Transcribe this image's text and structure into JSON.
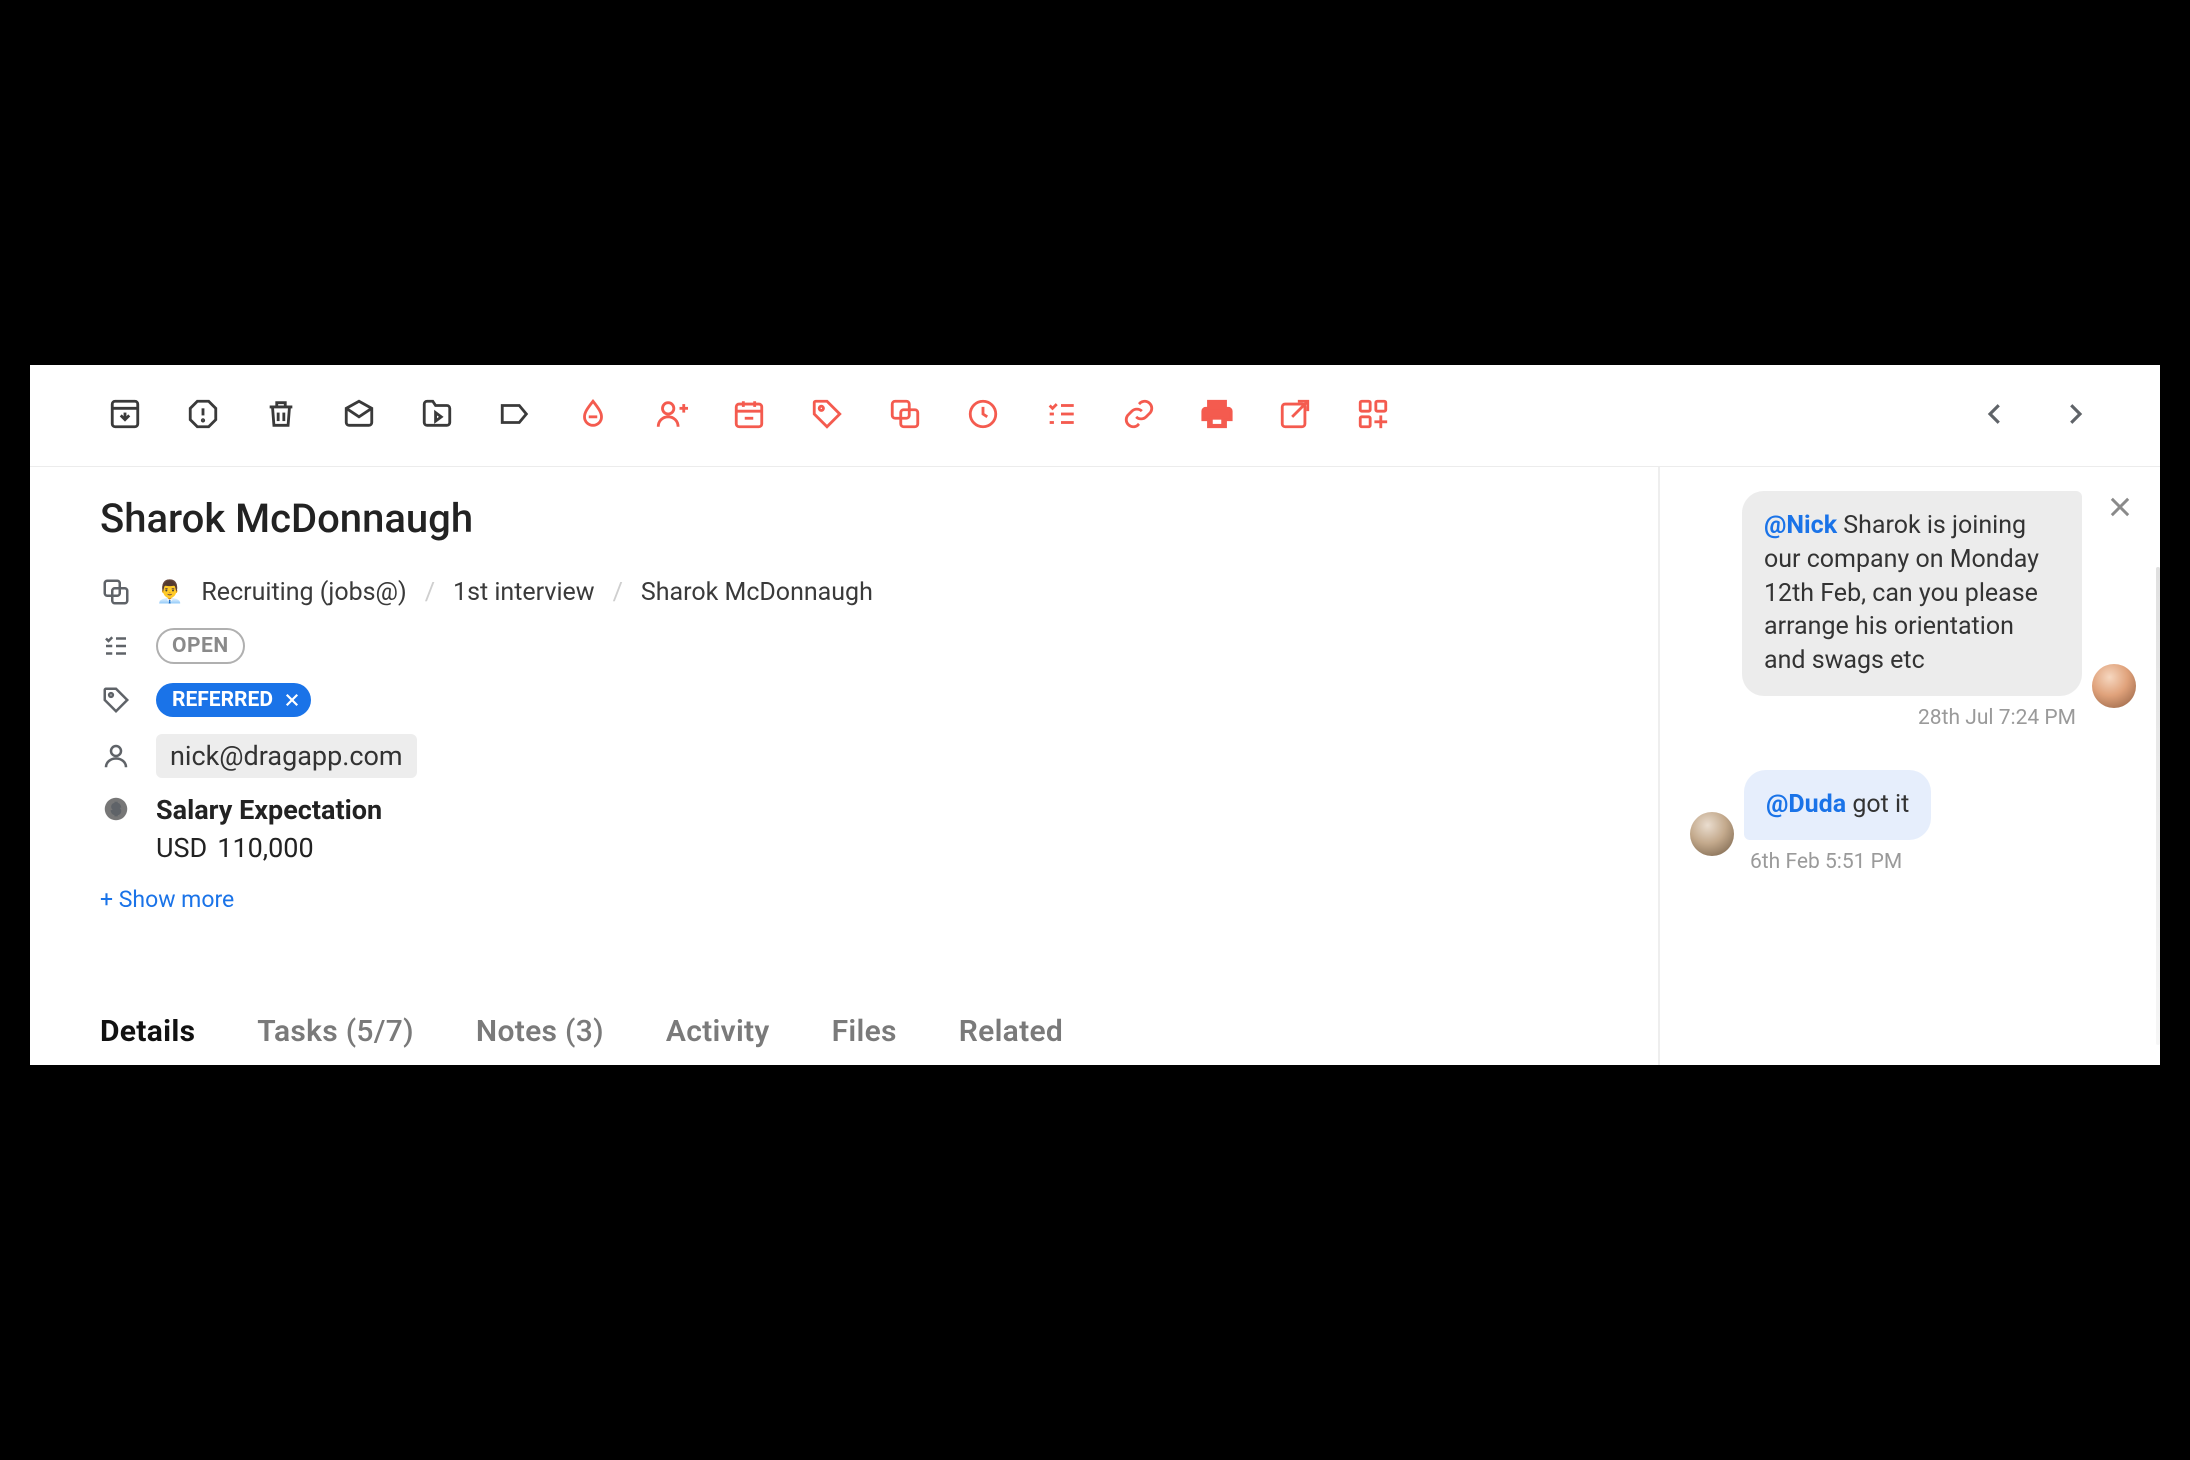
{
  "toolbar": {
    "icons": [
      {
        "name": "archive-icon",
        "color": "dark"
      },
      {
        "name": "spam-icon",
        "color": "dark"
      },
      {
        "name": "delete-icon",
        "color": "dark"
      },
      {
        "name": "mark-unread-icon",
        "color": "dark"
      },
      {
        "name": "move-to-icon",
        "color": "dark"
      },
      {
        "name": "label-icon",
        "color": "dark"
      },
      {
        "name": "drop-icon",
        "color": "red"
      },
      {
        "name": "assign-person-icon",
        "color": "red"
      },
      {
        "name": "due-date-icon",
        "color": "red"
      },
      {
        "name": "tag-icon",
        "color": "red"
      },
      {
        "name": "duplicate-card-icon",
        "color": "red"
      },
      {
        "name": "snooze-icon",
        "color": "red"
      },
      {
        "name": "checklist-icon",
        "color": "red"
      },
      {
        "name": "link-icon",
        "color": "red"
      },
      {
        "name": "print-icon",
        "color": "red"
      },
      {
        "name": "open-external-icon",
        "color": "red"
      },
      {
        "name": "apps-add-icon",
        "color": "red"
      }
    ]
  },
  "card": {
    "title": "Sharok McDonnaugh",
    "breadcrumb": {
      "board_emoji": "👨‍💼",
      "board": "Recruiting (jobs@)",
      "column": "1st interview",
      "item": "Sharok McDonnaugh"
    },
    "status": "OPEN",
    "tag": "REFERRED",
    "assignee_email": "nick@dragapp.com",
    "custom_field": {
      "label": "Salary Expectation",
      "currency": "USD",
      "value": "110,000"
    },
    "show_more": "+ Show more"
  },
  "tabs": [
    {
      "label": "Details",
      "active": true
    },
    {
      "label": "Tasks",
      "count": "(5/7)"
    },
    {
      "label": "Notes",
      "count": "(3)"
    },
    {
      "label": "Activity"
    },
    {
      "label": "Files"
    },
    {
      "label": "Related"
    }
  ],
  "chat": {
    "messages": [
      {
        "side": "right",
        "mention": "@Nick",
        "text": "Sharok is joining our company on Monday 12th Feb, can you please arrange his orientation and swags etc",
        "timestamp": "28th Jul 7:24 PM"
      },
      {
        "side": "left",
        "mention": "@Duda",
        "text": "got it",
        "timestamp": "6th Feb 5:51 PM"
      }
    ]
  }
}
